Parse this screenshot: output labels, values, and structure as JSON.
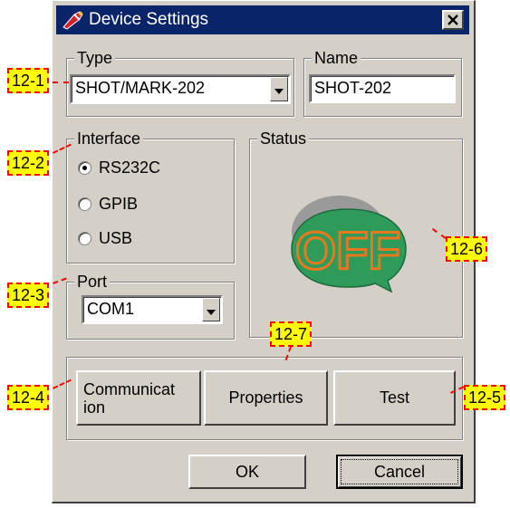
{
  "window": {
    "title": "Device Settings",
    "close_glyph": "✕"
  },
  "type_group": {
    "label": "Type",
    "selected": "SHOT/MARK-202"
  },
  "name_group": {
    "label": "Name",
    "value": "SHOT-202"
  },
  "interface_group": {
    "label": "Interface",
    "options": [
      {
        "label": "RS232C",
        "selected": true
      },
      {
        "label": "GPIB",
        "selected": false
      },
      {
        "label": "USB",
        "selected": false
      }
    ]
  },
  "port_group": {
    "label": "Port",
    "selected": "COM1"
  },
  "status_group": {
    "label": "Status",
    "indicator_text": "OFF"
  },
  "buttons": {
    "communication_line1": "Communicat",
    "communication_line2": "ion",
    "properties": "Properties",
    "test": "Test",
    "ok": "OK",
    "cancel": "Cancel"
  },
  "callouts": [
    "12-1",
    "12-2",
    "12-3",
    "12-4",
    "12-5",
    "12-6",
    "12-7"
  ],
  "colors": {
    "titlebar": "#0a246a",
    "dialog_face": "#d4d0c8",
    "status_green": "#2e9b5b",
    "status_text": "#e8781e",
    "callout_fill": "#ffff00",
    "callout_border": "#ff0000"
  }
}
